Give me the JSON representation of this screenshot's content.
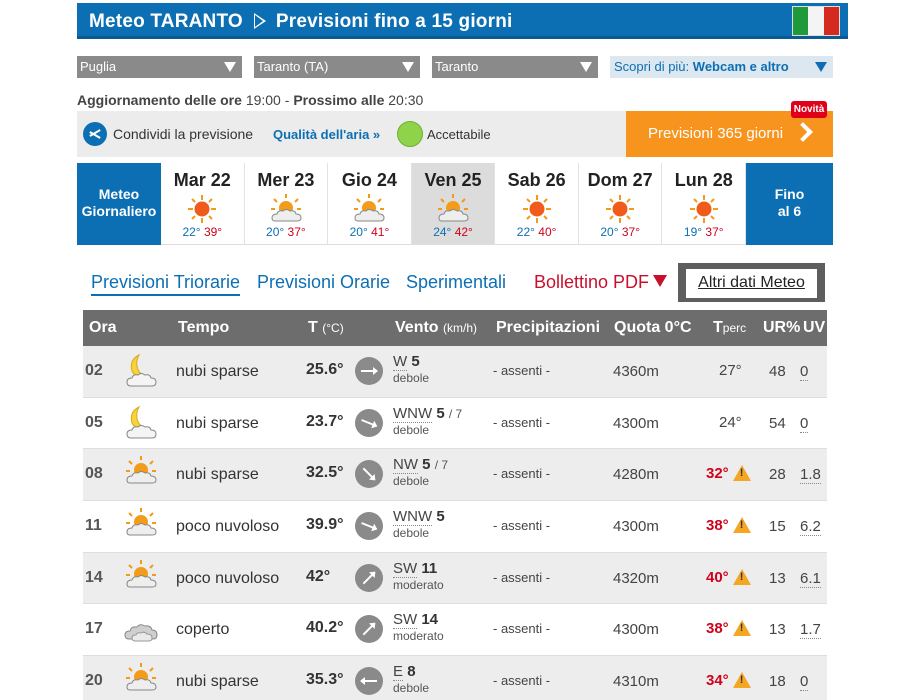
{
  "header": {
    "title_part1": "Meteo TARANTO",
    "title_part2": "Previsioni fino a 15 giorni"
  },
  "colors": {
    "brand_blue": "#0c6fb4",
    "orange": "#f7941d",
    "hot_red": "#d0021b",
    "air_good": "#8ed34a"
  },
  "selects": {
    "region": "Puglia",
    "province": "Taranto (TA)",
    "city": "Taranto"
  },
  "scopri": {
    "label": "Scopri di più:",
    "value": "Webcam e altro"
  },
  "update": {
    "label1": "Aggiornamento delle ore",
    "time1": "19:00",
    "sep": "-",
    "label2": "Prossimo alle",
    "time2": "20:30"
  },
  "share": {
    "label": "Condividi la previsione",
    "icon": "share-icon"
  },
  "air": {
    "label": "Qualità dell'aria »",
    "value": "Accettabile"
  },
  "p365": {
    "label": "Previsioni 365 giorni",
    "badge": "Novità"
  },
  "meteo_giornaliero": {
    "line1": "Meteo",
    "line2": "Giornaliero"
  },
  "fino": {
    "line1": "Fino",
    "line2": "al 6"
  },
  "days": [
    {
      "name": "Mar 22",
      "min": "22°",
      "max": "39°",
      "icon": "sun-icon"
    },
    {
      "name": "Mer 23",
      "min": "20°",
      "max": "37°",
      "icon": "sun-cloud-icon"
    },
    {
      "name": "Gio 24",
      "min": "20°",
      "max": "41°",
      "icon": "sun-cloud-icon"
    },
    {
      "name": "Ven 25",
      "min": "24°",
      "max": "42°",
      "icon": "sun-cloud-icon"
    },
    {
      "name": "Sab 26",
      "min": "22°",
      "max": "40°",
      "icon": "sun-icon"
    },
    {
      "name": "Dom 27",
      "min": "20°",
      "max": "37°",
      "icon": "sun-icon"
    },
    {
      "name": "Lun 28",
      "min": "19°",
      "max": "37°",
      "icon": "sun-icon"
    }
  ],
  "tabs": {
    "triorarie": "Previsioni Triorarie",
    "orarie": "Previsioni Orarie",
    "sperimentali": "Sperimentali",
    "pdf": "Bollettino PDF",
    "altri": "Altri dati Meteo"
  },
  "table": {
    "headers": {
      "ora": "Ora",
      "tempo": "Tempo",
      "t": "T",
      "t_unit": "(°C)",
      "vento": "Vento",
      "vento_unit": "(km/h)",
      "prec": "Precipitazioni",
      "quota": "Quota 0°C",
      "tperc_a": "T",
      "tperc_b": "perc",
      "ur": "UR%",
      "uv": "UV"
    },
    "rows": [
      {
        "ora": "02",
        "icon": "moon-cloud-icon",
        "tempo": "nubi sparse",
        "temp": "25.6°",
        "dir": "W",
        "speed": "5",
        "gust": "",
        "desc": "debole",
        "prec": "- assenti -",
        "quota": "4360m",
        "tperc": "27°",
        "hot": false,
        "ur": "48",
        "uv": "0"
      },
      {
        "ora": "05",
        "icon": "moon-cloud-icon",
        "tempo": "nubi sparse",
        "temp": "23.7°",
        "dir": "WNW",
        "speed": "5",
        "gust": "/ 7",
        "desc": "debole",
        "prec": "- assenti -",
        "quota": "4300m",
        "tperc": "24°",
        "hot": false,
        "ur": "54",
        "uv": "0"
      },
      {
        "ora": "08",
        "icon": "sun-cloud-icon",
        "tempo": "nubi sparse",
        "temp": "32.5°",
        "dir": "NW",
        "speed": "5",
        "gust": "/ 7",
        "desc": "debole",
        "prec": "- assenti -",
        "quota": "4280m",
        "tperc": "32°",
        "hot": true,
        "ur": "28",
        "uv": "1.8"
      },
      {
        "ora": "11",
        "icon": "sun-cloud-icon",
        "tempo": "poco nuvoloso",
        "temp": "39.9°",
        "dir": "WNW",
        "speed": "5",
        "gust": "",
        "desc": "debole",
        "prec": "- assenti -",
        "quota": "4300m",
        "tperc": "38°",
        "hot": true,
        "ur": "15",
        "uv": "6.2"
      },
      {
        "ora": "14",
        "icon": "sun-cloud-icon",
        "tempo": "poco nuvoloso",
        "temp": "42°",
        "dir": "SW",
        "speed": "11",
        "gust": "",
        "desc": "moderato",
        "prec": "- assenti -",
        "quota": "4320m",
        "tperc": "40°",
        "hot": true,
        "ur": "13",
        "uv": "6.1"
      },
      {
        "ora": "17",
        "icon": "cloud-icon",
        "tempo": "coperto",
        "temp": "40.2°",
        "dir": "SW",
        "speed": "14",
        "gust": "",
        "desc": "moderato",
        "prec": "- assenti -",
        "quota": "4300m",
        "tperc": "38°",
        "hot": true,
        "ur": "13",
        "uv": "1.7"
      },
      {
        "ora": "20",
        "icon": "sun-cloud-icon",
        "tempo": "nubi sparse",
        "temp": "35.3°",
        "dir": "E",
        "speed": "8",
        "gust": "",
        "desc": "debole",
        "prec": "- assenti -",
        "quota": "4310m",
        "tperc": "34°",
        "hot": true,
        "ur": "18",
        "uv": "0"
      }
    ]
  }
}
